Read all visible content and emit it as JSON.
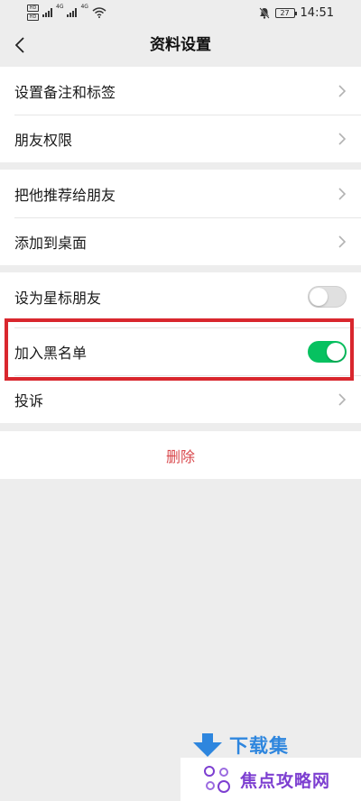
{
  "status_bar": {
    "left_badges": [
      "HD",
      "HD"
    ],
    "network_labels": [
      "4G",
      "4G"
    ],
    "battery": "27",
    "time": "14:51"
  },
  "nav": {
    "title": "资料设置"
  },
  "groups": [
    {
      "items": [
        {
          "label": "设置备注和标签"
        },
        {
          "label": "朋友权限"
        }
      ]
    },
    {
      "items": [
        {
          "label": "把他推荐给朋友"
        },
        {
          "label": "添加到桌面"
        }
      ]
    },
    {
      "items": [
        {
          "label": "设为星标朋友",
          "toggle": false
        },
        {
          "label": "加入黑名单",
          "toggle": true
        },
        {
          "label": "投诉"
        }
      ]
    }
  ],
  "delete_label": "删除",
  "colors": {
    "accent_green": "#07c160",
    "highlight_red": "#d9272e",
    "delete_red": "#d9494d",
    "background": "#ededed"
  },
  "watermark": {
    "top": "下载集",
    "bottom": "焦点攻略网"
  }
}
